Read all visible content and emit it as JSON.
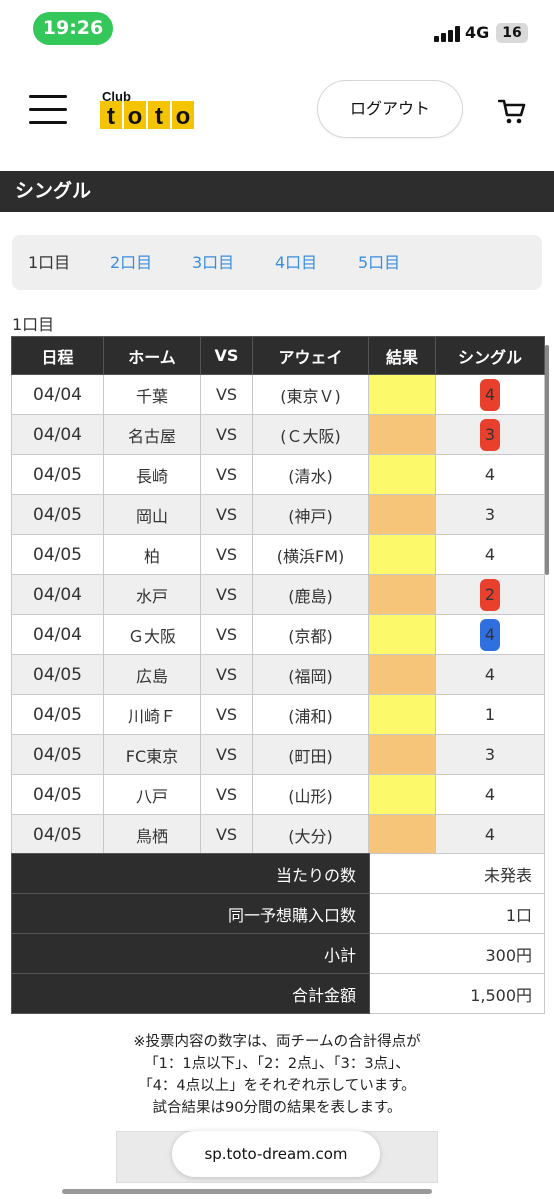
{
  "status": {
    "time": "19:26",
    "network": "4G",
    "battery": "16"
  },
  "header": {
    "logo_top": "Club",
    "logo_main": "toto",
    "logout_label": "ログアウト"
  },
  "section_title": "シングル",
  "tabs": [
    "1口目",
    "2口目",
    "3口目",
    "4口目",
    "5口目"
  ],
  "round_label": "1口目",
  "table": {
    "headers": [
      "日程",
      "ホーム",
      "VS",
      "アウェイ",
      "結果",
      "シングル"
    ],
    "rows": [
      {
        "date": "04/04",
        "home": "千葉",
        "vs": "VS",
        "away": "(東京Ｖ)",
        "result": "",
        "single": "4"
      },
      {
        "date": "04/04",
        "home": "名古屋",
        "vs": "VS",
        "away": "(Ｃ大阪)",
        "result": "",
        "single": "3"
      },
      {
        "date": "04/05",
        "home": "長崎",
        "vs": "VS",
        "away": "(清水)",
        "result": "",
        "single": "4"
      },
      {
        "date": "04/05",
        "home": "岡山",
        "vs": "VS",
        "away": "(神戸)",
        "result": "",
        "single": "3"
      },
      {
        "date": "04/05",
        "home": "柏",
        "vs": "VS",
        "away": "(横浜FM)",
        "result": "",
        "single": "4"
      },
      {
        "date": "04/04",
        "home": "水戸",
        "vs": "VS",
        "away": "(鹿島)",
        "result": "",
        "single": "2"
      },
      {
        "date": "04/04",
        "home": "Ｇ大阪",
        "vs": "VS",
        "away": "(京都)",
        "result": "",
        "single": "4"
      },
      {
        "date": "04/05",
        "home": "広島",
        "vs": "VS",
        "away": "(福岡)",
        "result": "",
        "single": "4"
      },
      {
        "date": "04/05",
        "home": "川崎Ｆ",
        "vs": "VS",
        "away": "(浦和)",
        "result": "",
        "single": "1"
      },
      {
        "date": "04/05",
        "home": "FC東京",
        "vs": "VS",
        "away": "(町田)",
        "result": "",
        "single": "3"
      },
      {
        "date": "04/05",
        "home": "八戸",
        "vs": "VS",
        "away": "(山形)",
        "result": "",
        "single": "4"
      },
      {
        "date": "04/05",
        "home": "鳥栖",
        "vs": "VS",
        "away": "(大分)",
        "result": "",
        "single": "4"
      }
    ]
  },
  "summary": [
    {
      "label": "当たりの数",
      "value": "未発表"
    },
    {
      "label": "同一予想購入口数",
      "value": "1口"
    },
    {
      "label": "小計",
      "value": "300円"
    },
    {
      "label": "合計金額",
      "value": "1,500円"
    }
  ],
  "note": [
    "※投票内容の数字は、両チームの合計得点が",
    "「1：1点以下」、「2：2点」、「3：3点」、",
    "「4：4点以上」をそれぞれ示しています。",
    "試合結果は90分間の結果を表します。"
  ],
  "url": "sp.toto-dream.com",
  "colors": {
    "result_yellow": "#fcf96a",
    "result_orange": "#f6c57a",
    "highlight_red": "#e8402c",
    "highlight_blue": "#2f6fe0",
    "header_dark": "#2d2d2d",
    "link_blue": "#3a8edb"
  }
}
